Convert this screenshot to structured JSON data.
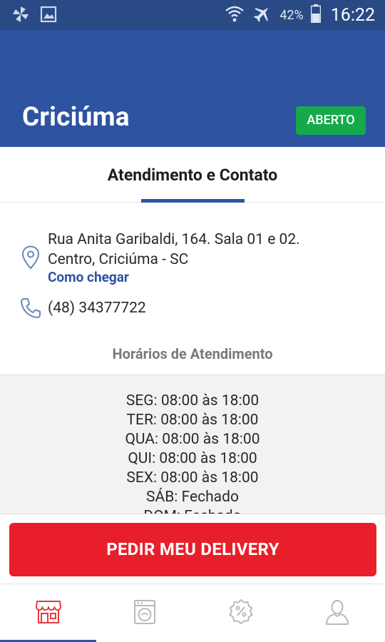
{
  "status_bar": {
    "icons_left": [
      "pinwheel-icon",
      "image-icon"
    ],
    "icons_right": [
      "wifi-icon",
      "airplane-mode-icon",
      "battery-icon"
    ],
    "battery": "42%",
    "time": "16:22"
  },
  "header": {
    "title": "Criciúma",
    "status_badge": "ABERTO",
    "colors": {
      "primary": "#2e53a0",
      "status_bar": "#294a85",
      "badge": "#15a94c"
    }
  },
  "tab": {
    "label": "Atendimento e Contato"
  },
  "contact": {
    "address_line1": "Rua Anita Garibaldi, 164. Sala 01 e 02.",
    "address_line2": "Centro, Criciúma - SC",
    "directions_link": "Como chegar",
    "phone": "(48) 34377722"
  },
  "hours": {
    "title": "Horários de Atendimento",
    "lines": [
      "SEG: 08:00 às 18:00",
      "TER: 08:00 às 18:00",
      "QUA: 08:00 às 18:00",
      "QUI: 08:00 às 18:00",
      "SEX: 08:00 às 18:00",
      "SÁB: Fechado",
      "DOM: Fechado"
    ]
  },
  "cta": {
    "label": "PEDIR MEU DELIVERY",
    "color": "#e81f2a"
  },
  "bottom_nav": {
    "items": [
      {
        "icon": "store-icon",
        "active": true
      },
      {
        "icon": "washing-machine-icon",
        "active": false
      },
      {
        "icon": "discount-badge-icon",
        "active": false
      },
      {
        "icon": "user-icon",
        "active": false
      }
    ]
  }
}
